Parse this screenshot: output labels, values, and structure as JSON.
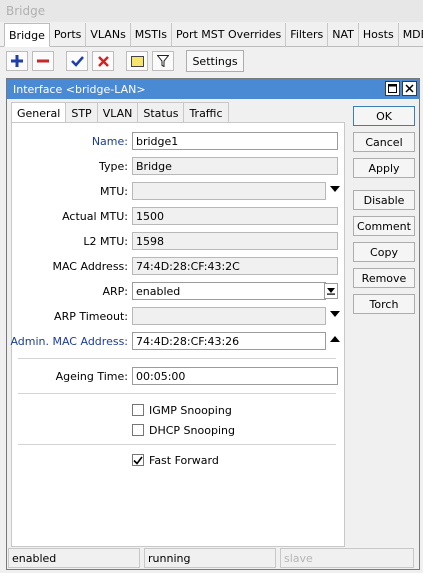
{
  "window": {
    "title": "Bridge"
  },
  "main_tabs": [
    "Bridge",
    "Ports",
    "VLANs",
    "MSTIs",
    "Port MST Overrides",
    "Filters",
    "NAT",
    "Hosts",
    "MDB"
  ],
  "toolbar": {
    "settings_label": "Settings"
  },
  "dialog": {
    "title": "Interface <bridge-LAN>",
    "tabs": [
      "General",
      "STP",
      "VLAN",
      "Status",
      "Traffic"
    ],
    "fields": {
      "name": {
        "label": "Name:",
        "value": "bridge1"
      },
      "type": {
        "label": "Type:",
        "value": "Bridge"
      },
      "mtu": {
        "label": "MTU:",
        "value": ""
      },
      "actual_mtu": {
        "label": "Actual MTU:",
        "value": "1500"
      },
      "l2_mtu": {
        "label": "L2 MTU:",
        "value": "1598"
      },
      "mac_address": {
        "label": "MAC Address:",
        "value": "74:4D:28:CF:43:2C"
      },
      "arp": {
        "label": "ARP:",
        "value": "enabled"
      },
      "arp_timeout": {
        "label": "ARP Timeout:",
        "value": ""
      },
      "admin_mac": {
        "label": "Admin. MAC Address:",
        "value": "74:4D:28:CF:43:26"
      },
      "ageing_time": {
        "label": "Ageing Time:",
        "value": "00:05:00"
      }
    },
    "checkboxes": {
      "igmp_snooping": {
        "label": "IGMP Snooping",
        "checked": false
      },
      "dhcp_snooping": {
        "label": "DHCP Snooping",
        "checked": false
      },
      "fast_forward": {
        "label": "Fast Forward",
        "checked": true
      }
    },
    "buttons": {
      "ok": "OK",
      "cancel": "Cancel",
      "apply": "Apply",
      "disable": "Disable",
      "comment": "Comment",
      "copy": "Copy",
      "remove": "Remove",
      "torch": "Torch"
    },
    "status": {
      "state": "enabled",
      "running": "running",
      "slave": "slave"
    }
  },
  "colors": {
    "title_bar": "#4a8ad4",
    "label_blue": "#1c3c98",
    "add_icon": "#1f3fa8",
    "remove_icon": "#c62828",
    "check_icon": "#1f3fa8",
    "x_icon": "#c62828"
  },
  "icons": [
    "add-icon",
    "remove-icon",
    "enable-icon",
    "disable-icon",
    "comment-icon",
    "filter-icon"
  ]
}
